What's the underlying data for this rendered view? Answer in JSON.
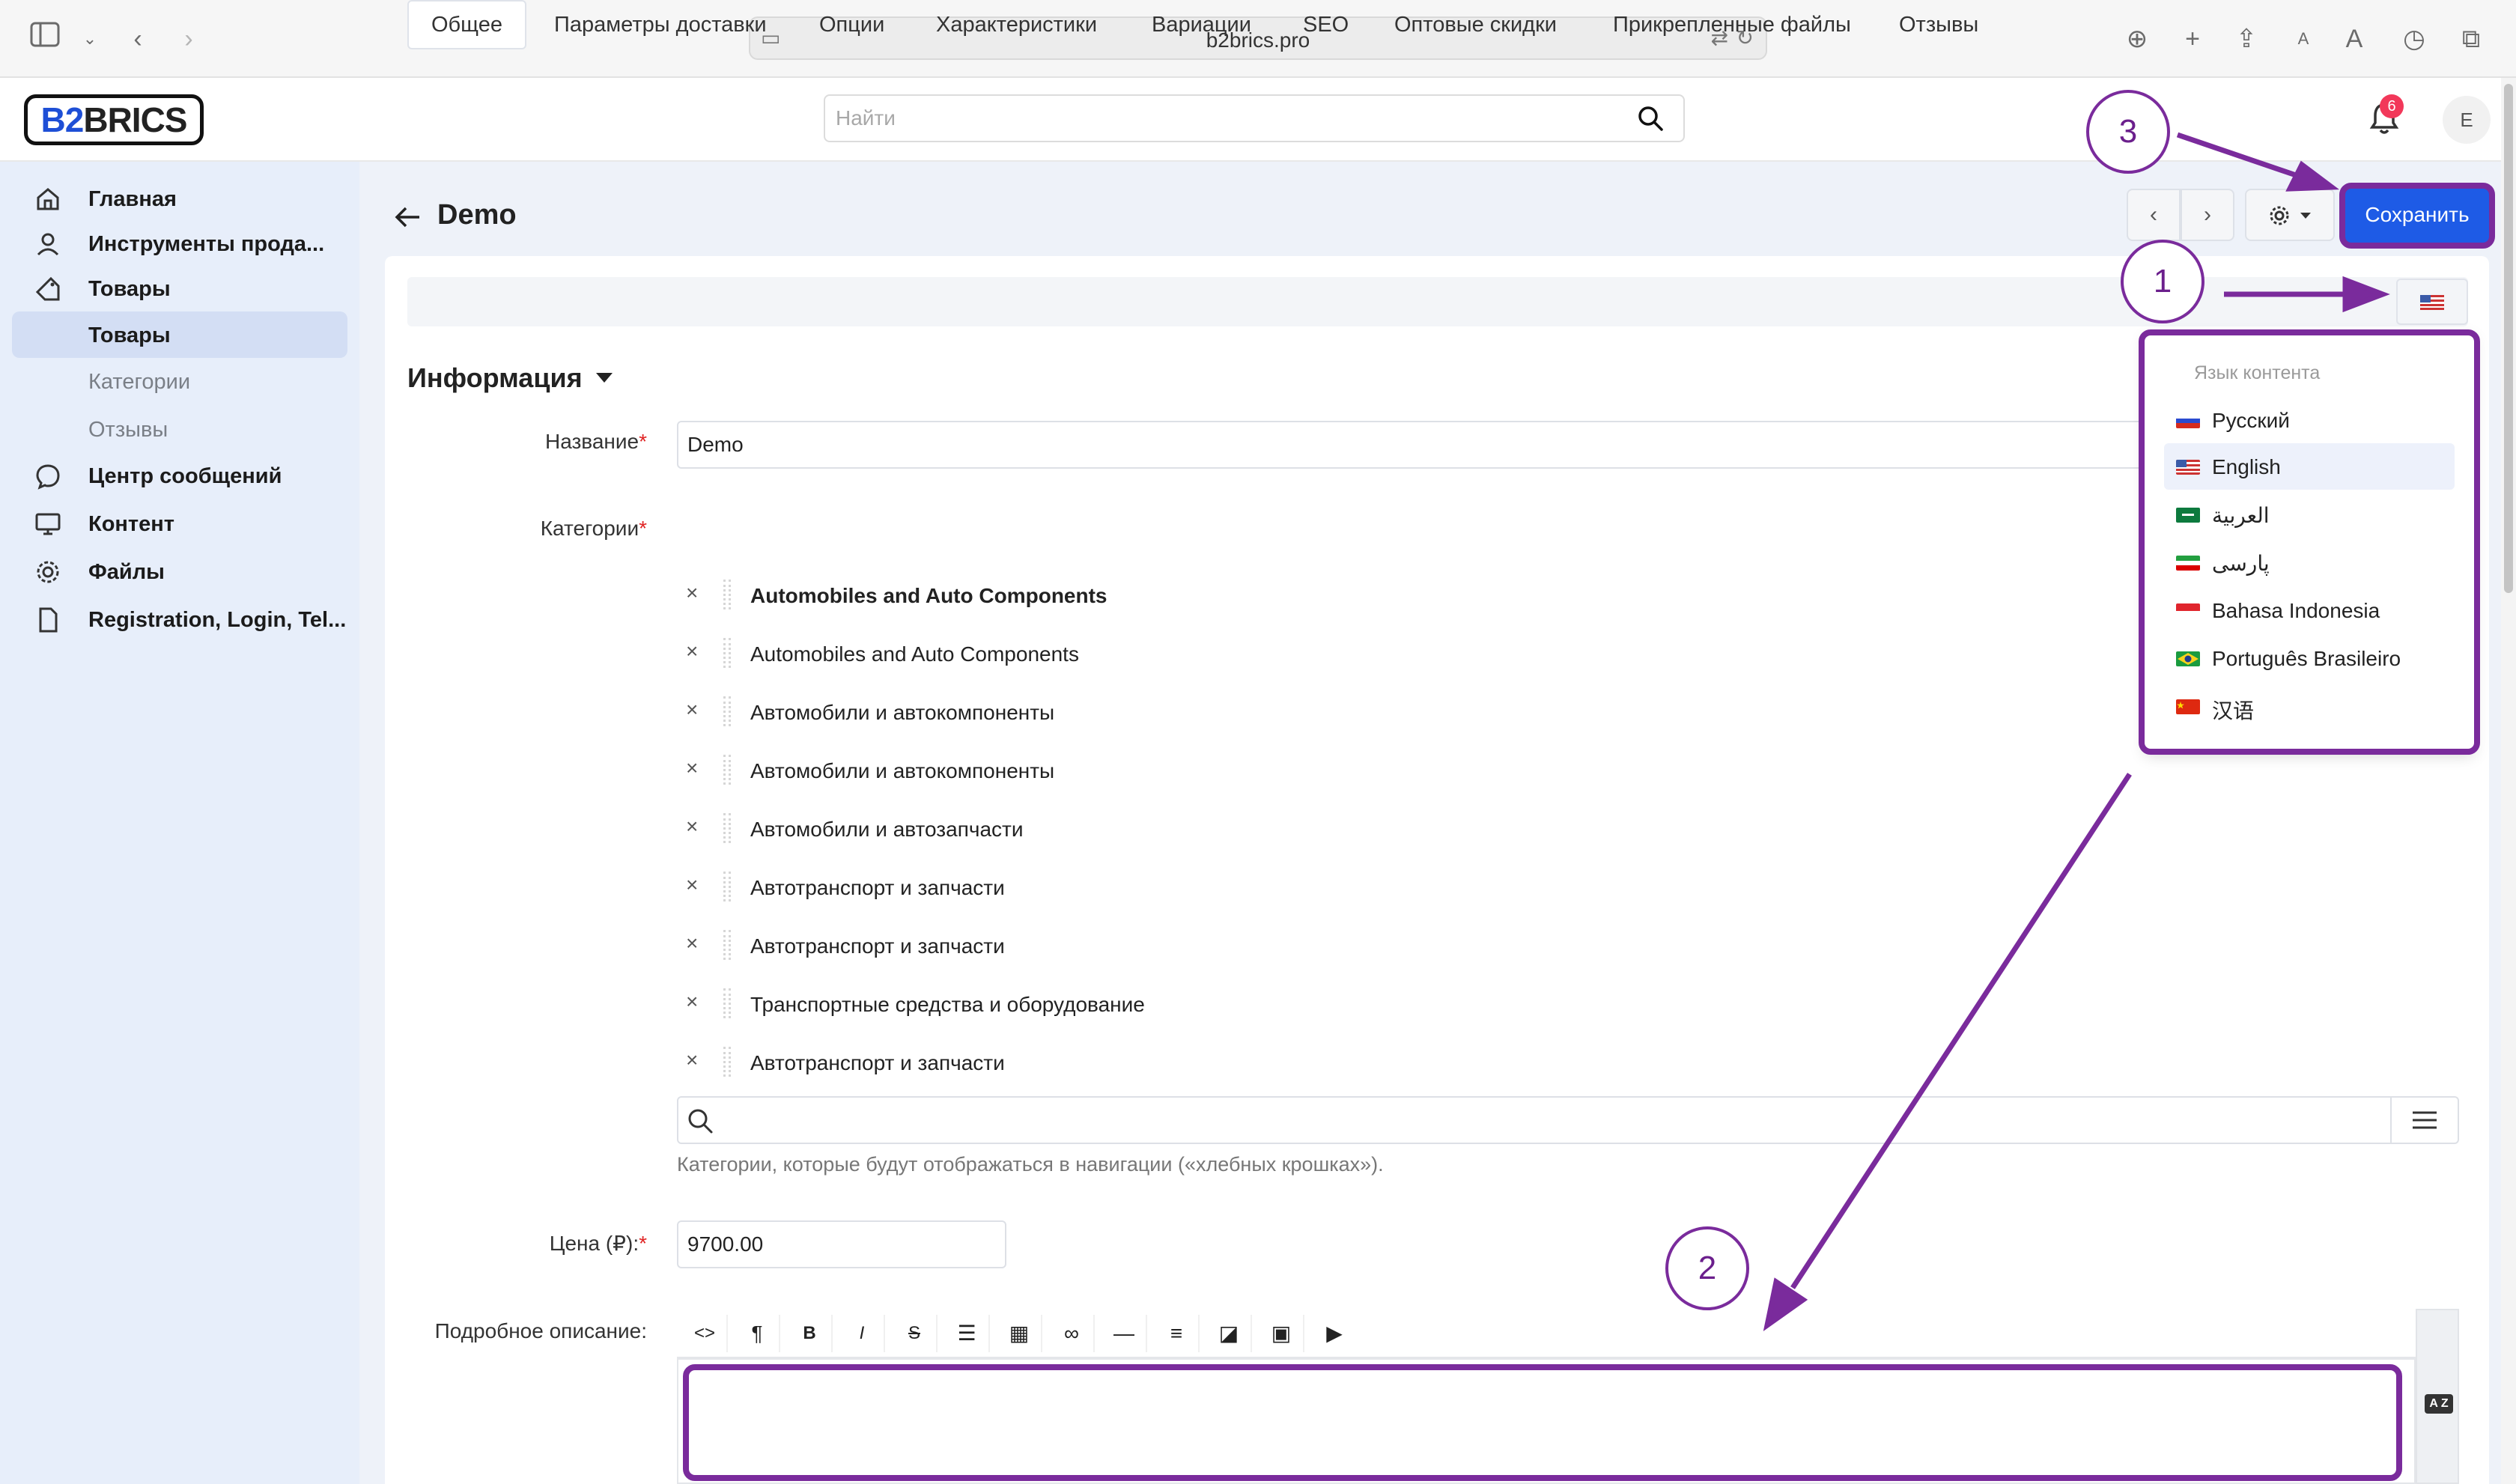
{
  "browser": {
    "url": "b2brics.pro"
  },
  "header": {
    "logo_prefix": "B2",
    "logo_suffix": "BRICS",
    "search_placeholder": "Найти",
    "notifications_count": "6",
    "avatar_initial": "E"
  },
  "sidebar": {
    "items": [
      {
        "label": "Главная",
        "icon": "home-icon"
      },
      {
        "label": "Инструменты прода...",
        "icon": "user-icon"
      },
      {
        "label": "Товары",
        "icon": "tag-icon"
      },
      {
        "label": "Товары",
        "icon": ""
      },
      {
        "label": "Категории",
        "icon": ""
      },
      {
        "label": "Отзывы",
        "icon": ""
      },
      {
        "label": "Центр сообщений",
        "icon": "chat-icon"
      },
      {
        "label": "Контент",
        "icon": "monitor-icon"
      },
      {
        "label": "Файлы",
        "icon": "gear-icon"
      },
      {
        "label": "Registration, Login, Tel...",
        "icon": "document-icon"
      }
    ]
  },
  "page": {
    "title": "Demo",
    "save_label": "Сохранить"
  },
  "tabs": [
    "Общее",
    "Параметры доставки",
    "Опции",
    "Характеристики",
    "Вариации",
    "SEO",
    "Оптовые скидки",
    "Прикрепленные файлы",
    "Отзывы"
  ],
  "section": {
    "title": "Информация"
  },
  "form": {
    "name_label": "Название",
    "name_value": "Demo",
    "categories_label": "Категории",
    "categories": [
      "Automobiles and Auto Components",
      "Automobiles and Auto Components",
      "Автомобили и автокомпоненты",
      "Автомобили и автокомпоненты",
      "Автомобили и автозапчасти",
      "Автотранспорт и запчасти",
      "Автотранспорт и запчасти",
      "Транспортные средства и оборудование",
      "Автотранспорт и запчасти"
    ],
    "categories_hint": "Категории, которые будут отображаться в навигации («хлебных крошках»).",
    "price_label": "Цена (₽):",
    "price_value": "9700.00",
    "description_label": "Подробное описание:",
    "required_mark": "*"
  },
  "language_dropdown": {
    "header": "Язык контента",
    "selected": "English",
    "options": [
      {
        "label": "Русский",
        "flag": "ru"
      },
      {
        "label": "English",
        "flag": "us"
      },
      {
        "label": "العربية",
        "flag": "sa"
      },
      {
        "label": "پارسی",
        "flag": "ir"
      },
      {
        "label": "Bahasa Indonesia",
        "flag": "id"
      },
      {
        "label": "Português Brasileiro",
        "flag": "br"
      },
      {
        "label": "汉语",
        "flag": "cn"
      }
    ]
  },
  "annotations": {
    "step1": "1",
    "step2": "2",
    "step3": "3",
    "color": "#7a2b9c"
  },
  "colors": {
    "accent": "#1e5be6",
    "sidebar_bg": "#e7eefa",
    "required": "#e02424"
  }
}
